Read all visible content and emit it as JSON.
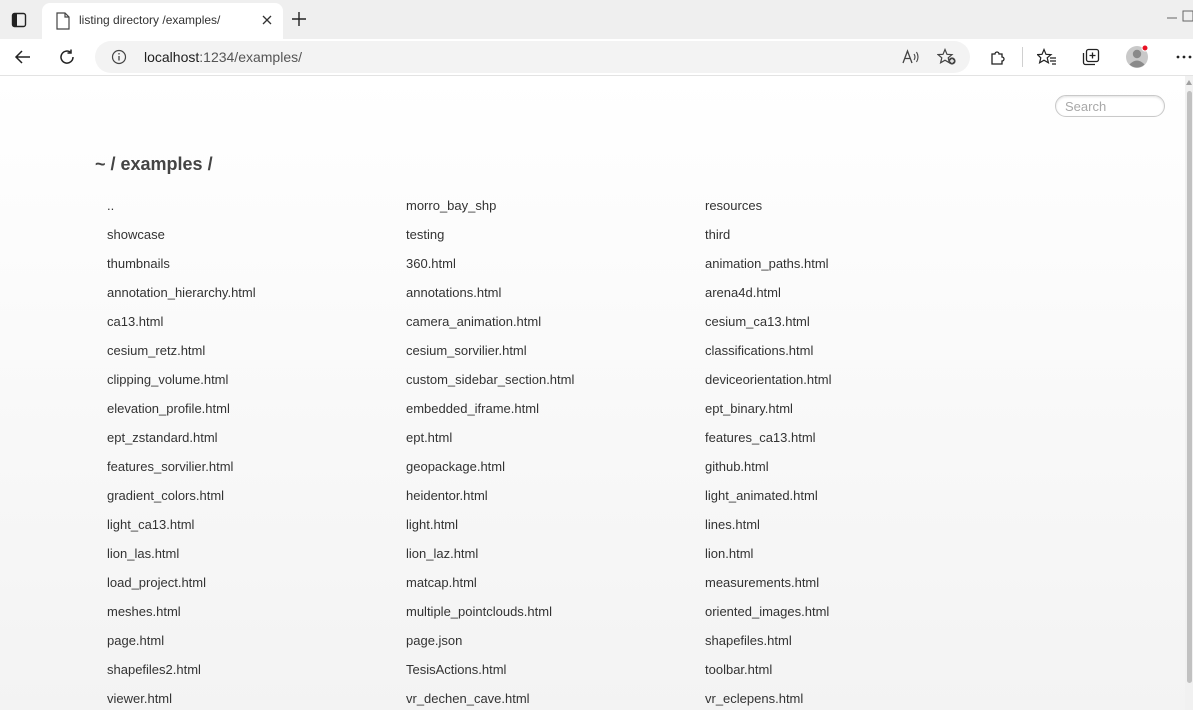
{
  "browser": {
    "tab_title": "listing directory /examples/",
    "url_host": "localhost",
    "url_rest": ":1234/examples/"
  },
  "page": {
    "search_placeholder": "Search",
    "heading": "~ / examples /"
  },
  "files": [
    "..",
    "morro_bay_shp",
    "resources",
    "showcase",
    "testing",
    "third",
    "thumbnails",
    "360.html",
    "animation_paths.html",
    "annotation_hierarchy.html",
    "annotations.html",
    "arena4d.html",
    "ca13.html",
    "camera_animation.html",
    "cesium_ca13.html",
    "cesium_retz.html",
    "cesium_sorvilier.html",
    "classifications.html",
    "clipping_volume.html",
    "custom_sidebar_section.html",
    "deviceorientation.html",
    "elevation_profile.html",
    "embedded_iframe.html",
    "ept_binary.html",
    "ept_zstandard.html",
    "ept.html",
    "features_ca13.html",
    "features_sorvilier.html",
    "geopackage.html",
    "github.html",
    "gradient_colors.html",
    "heidentor.html",
    "light_animated.html",
    "light_ca13.html",
    "light.html",
    "lines.html",
    "lion_las.html",
    "lion_laz.html",
    "lion.html",
    "load_project.html",
    "matcap.html",
    "measurements.html",
    "meshes.html",
    "multiple_pointclouds.html",
    "oriented_images.html",
    "page.html",
    "page.json",
    "shapefiles.html",
    "shapefiles2.html",
    "TesisActions.html",
    "toolbar.html",
    "viewer.html",
    "vr_dechen_cave.html",
    "vr_eclepens.html"
  ],
  "colors": {
    "tabstrip": "#efefef",
    "address_bar": "#f3f3f3",
    "text": "#333333",
    "heading": "#444444",
    "profile_dot": "#e81123"
  }
}
